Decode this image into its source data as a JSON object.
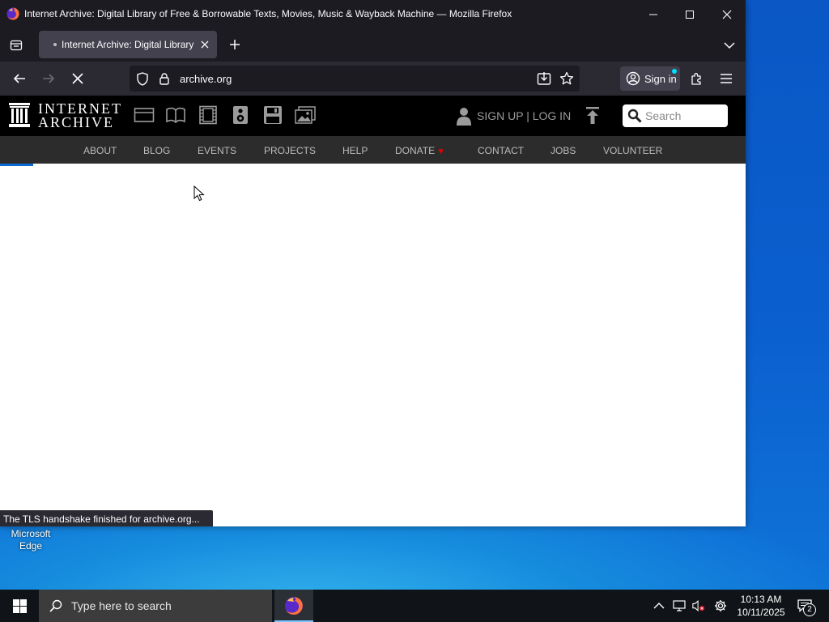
{
  "window": {
    "title": "Internet Archive: Digital Library of Free & Borrowable Texts, Movies, Music & Wayback Machine — Mozilla Firefox"
  },
  "tabs": [
    {
      "label": "Internet Archive: Digital Library"
    }
  ],
  "urlbar": {
    "url": "archive.org"
  },
  "toolbar": {
    "signin_label": "Sign in"
  },
  "site": {
    "logo_line1": "INTERNET",
    "logo_line2": "ARCHIVE",
    "auth_link": "SIGN UP | LOG IN",
    "search_placeholder": "Search",
    "nav": [
      {
        "label": "ABOUT"
      },
      {
        "label": "BLOG"
      },
      {
        "label": "EVENTS"
      },
      {
        "label": "PROJECTS"
      },
      {
        "label": "HELP"
      },
      {
        "label": "DONATE"
      },
      {
        "label": "CONTACT"
      },
      {
        "label": "JOBS"
      },
      {
        "label": "VOLUNTEER"
      }
    ]
  },
  "status": {
    "text": "The TLS handshake finished for archive.org..."
  },
  "desktop": {
    "icon_label": "Microsoft Edge"
  },
  "taskbar": {
    "search_placeholder": "Type here to search",
    "time": "10:13 AM",
    "date": "10/11/2025",
    "notification_count": "2"
  },
  "colors": {
    "firefox_titlebar": "#1c1b22",
    "firefox_toolbar": "#2b2a33",
    "ia_header": "#000000",
    "ia_nav": "#2c2c2c",
    "donate_heart": "#e60000",
    "load_progress": "#0c6bd1"
  }
}
